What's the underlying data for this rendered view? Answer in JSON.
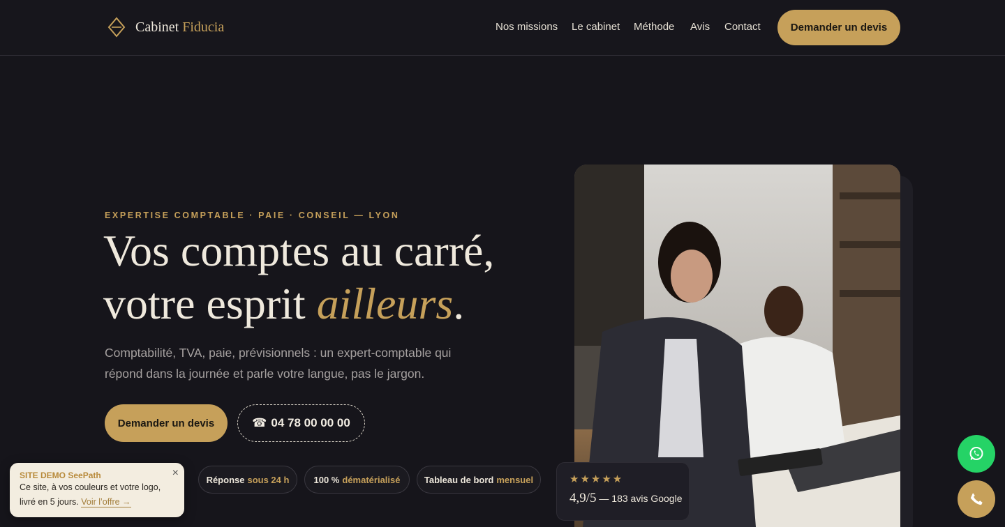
{
  "header": {
    "brand_main": "Cabinet",
    "brand_accent": "Fiducia",
    "nav": [
      "Nos missions",
      "Le cabinet",
      "Méthode",
      "Avis",
      "Contact"
    ],
    "cta": "Demander un devis"
  },
  "hero": {
    "eyebrow": "EXPERTISE COMPTABLE · PAIE · CONSEIL — LYON",
    "headline_line1": "Vos comptes au carré,",
    "headline_line2_start": "votre esprit ",
    "headline_accent": "ailleurs",
    "headline_end": ".",
    "lead": "Comptabilité, TVA, paie, prévisionnels : un expert-comptable qui répond dans la journée et parle votre langue, pas le jargon.",
    "cta_primary": "Demander un devis",
    "phone_icon": "☎",
    "phone": "04 78 00 00 00",
    "pills": [
      {
        "strong": "Réponse",
        "accent": "sous 24 h"
      },
      {
        "strong": "100 %",
        "accent": "dématérialisé"
      },
      {
        "strong": "Tableau de bord",
        "accent": "mensuel"
      }
    ]
  },
  "rating": {
    "stars": "★★★★★",
    "score": "4,9/5",
    "label": " — 183 avis Google"
  },
  "toast": {
    "title": "SITE DEMO SeePath",
    "body": "Ce site, à vos couleurs et votre logo, livré en 5 jours. ",
    "link": "Voir l’offre →",
    "close": "×"
  },
  "icons": {
    "logo": "diamond-logo-icon",
    "whatsapp": "whatsapp-icon",
    "call": "phone-icon"
  },
  "colors": {
    "background": "#16151b",
    "accent": "#c6a05a",
    "whatsapp": "#25d366"
  }
}
